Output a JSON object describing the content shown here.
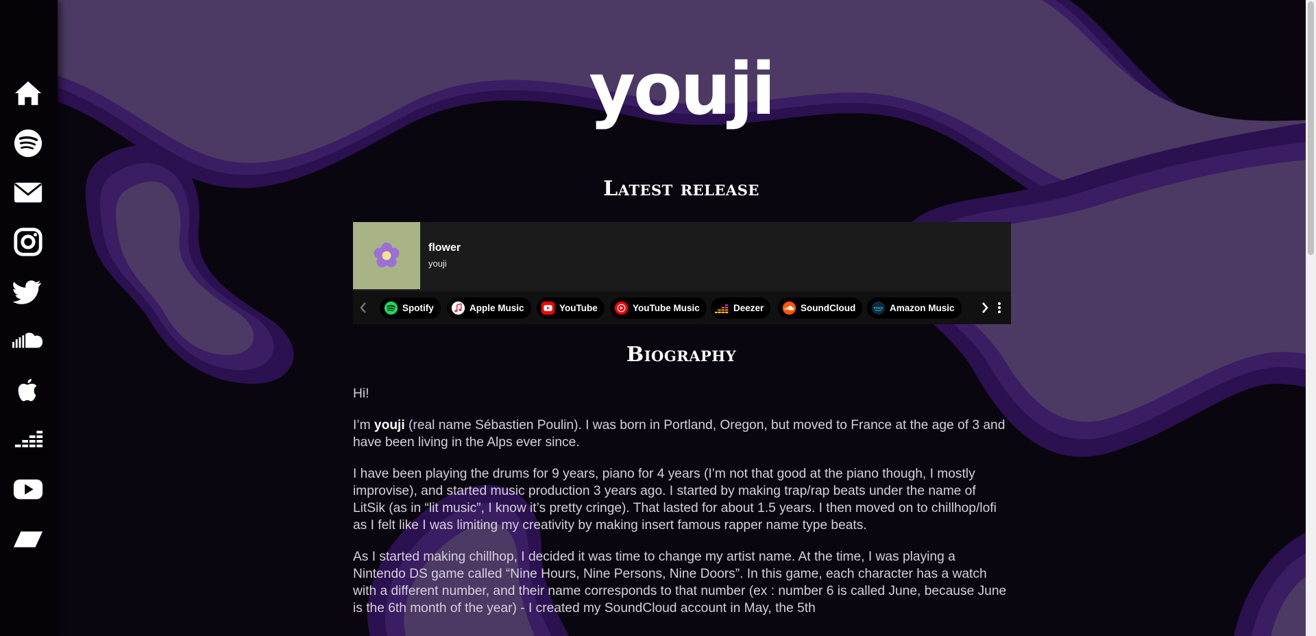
{
  "site": {
    "logo": "youji"
  },
  "sidebar": {
    "items": [
      {
        "name": "home",
        "icon": "home-icon"
      },
      {
        "name": "spotify",
        "icon": "spotify-icon"
      },
      {
        "name": "mail",
        "icon": "mail-icon"
      },
      {
        "name": "instagram",
        "icon": "instagram-icon"
      },
      {
        "name": "twitter",
        "icon": "twitter-icon"
      },
      {
        "name": "soundcloud",
        "icon": "soundcloud-icon"
      },
      {
        "name": "apple",
        "icon": "apple-icon"
      },
      {
        "name": "deezer",
        "icon": "deezer-icon"
      },
      {
        "name": "youtube",
        "icon": "youtube-icon"
      },
      {
        "name": "parallelogram",
        "icon": "parallelogram-icon"
      }
    ]
  },
  "latest_release": {
    "heading": "Latest release",
    "track": {
      "title": "flower",
      "artist": "youji"
    },
    "platforms": [
      {
        "label": "Spotify",
        "icon": "spotify-icon",
        "color": "#1ed760"
      },
      {
        "label": "Apple Music",
        "icon": "apple-music-icon",
        "color": "#fa2d48"
      },
      {
        "label": "YouTube",
        "icon": "youtube-icon",
        "color": "#ff0000"
      },
      {
        "label": "YouTube Music",
        "icon": "youtube-music-icon",
        "color": "#ff0000"
      },
      {
        "label": "Deezer",
        "icon": "deezer-icon",
        "color": "#ef5466"
      },
      {
        "label": "SoundCloud",
        "icon": "soundcloud-icon",
        "color": "#ff5500"
      },
      {
        "label": "Amazon Music",
        "icon": "amazon-music-icon",
        "color": "#25d1da"
      }
    ]
  },
  "biography": {
    "heading": "Biography",
    "p1": "Hi!",
    "p2_pre": "I’m ",
    "p2_bold": "youji",
    "p2_post": " (real name Sébastien Poulin). I was born in Portland, Oregon, but moved to France at the age of 3 and have been living in the Alps ever since.",
    "p3": "I have been playing the drums for 9 years, piano for 4 years (I’m not that good at the piano though, I mostly improvise), and started music production 3 years ago. I started by making trap/rap beats under the name of LitSik (as in “lit music”, I know it’s pretty cringe). That lasted for about 1.5 years. I then moved on to chillhop/lofi as I felt like I was limiting my creativity by making insert famous rapper name type beats.",
    "p4": "As I started making chillhop, I decided it was time to change my artist name. At the time, I was playing a Nintendo DS game called “Nine Hours, Nine Persons, Nine Doors”. In this game, each character has a watch with a different number, and their name corresponds to that number (ex : number 6 is called June, because June is the 6th month of the year) - I created my SoundCloud account in May, the 5th"
  },
  "colors": {
    "background": "#0a0610",
    "purple_dark": "#2c1150",
    "purple_light": "#4c3a64",
    "player": "#1b1b1b"
  }
}
